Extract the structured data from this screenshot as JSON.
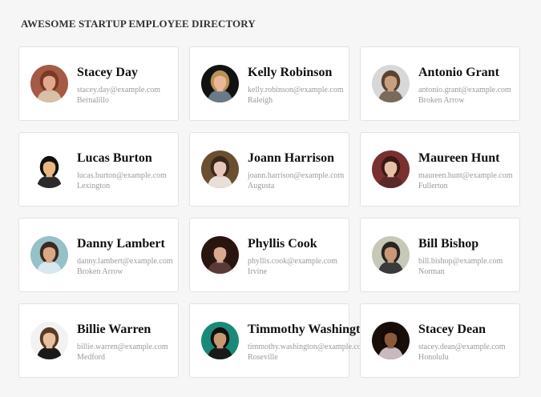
{
  "page": {
    "title": "AWESOME STARTUP EMPLOYEE DIRECTORY"
  },
  "employees": [
    {
      "name": "Stacey Day",
      "email": "stacey.day@example.com",
      "city": "Bernalillo",
      "avatar": {
        "bg": "#a45a44",
        "skin": "#e0a88c",
        "hair": "#7a3a22",
        "shirt": "#d8c0a8"
      }
    },
    {
      "name": "Kelly Robinson",
      "email": "kelly.robinson@example.com",
      "city": "Raleigh",
      "avatar": {
        "bg": "#121212",
        "skin": "#e8b898",
        "hair": "#b89058",
        "shirt": "#6a7a88"
      }
    },
    {
      "name": "Antonio Grant",
      "email": "antonio.grant@example.com",
      "city": "Broken Arrow",
      "avatar": {
        "bg": "#d8d8d8",
        "skin": "#c8a080",
        "hair": "#5a4430",
        "shirt": "#7a6a5a"
      }
    },
    {
      "name": "Lucas Burton",
      "email": "lucas.burton@example.com",
      "city": "Lexington",
      "avatar": {
        "bg": "#ffffff",
        "skin": "#e8b880",
        "hair": "#111111",
        "shirt": "#2a2a2a"
      }
    },
    {
      "name": "Joann Harrison",
      "email": "joann.harrison@example.com",
      "city": "Augusta",
      "avatar": {
        "bg": "#6a5030",
        "skin": "#e8c8b8",
        "hair": "#3a2818",
        "shirt": "#e8e0d8"
      }
    },
    {
      "name": "Maureen Hunt",
      "email": "maureen.hunt@example.com",
      "city": "Fullerton",
      "avatar": {
        "bg": "#7a3030",
        "skin": "#e8c0a8",
        "hair": "#3a1a12",
        "shirt": "#5a2a2a"
      }
    },
    {
      "name": "Danny Lambert",
      "email": "danny.lambert@example.com",
      "city": "Broken Arrow",
      "avatar": {
        "bg": "#98c0c8",
        "skin": "#d8a888",
        "hair": "#3a2a20",
        "shirt": "#d8e8f0"
      }
    },
    {
      "name": "Phyllis Cook",
      "email": "phyllis.cook@example.com",
      "city": "Irvine",
      "avatar": {
        "bg": "#2a1410",
        "skin": "#d8a890",
        "hair": "#2a1610",
        "shirt": "#5a3a38"
      }
    },
    {
      "name": "Bill Bishop",
      "email": "bill.bishop@example.com",
      "city": "Norman",
      "avatar": {
        "bg": "#c8c8b8",
        "skin": "#c89878",
        "hair": "#2a2420",
        "shirt": "#3a3a3a"
      }
    },
    {
      "name": "Billie Warren",
      "email": "billie.warren@example.com",
      "city": "Medford",
      "avatar": {
        "bg": "#f2f2f2",
        "skin": "#e8c0a0",
        "hair": "#5a3a22",
        "shirt": "#1a1a1a"
      }
    },
    {
      "name": "Timmothy Washington",
      "email": "timmothy.washington@example.com",
      "city": "Roseville",
      "avatar": {
        "bg": "#1a8a78",
        "skin": "#c89870",
        "hair": "#111111",
        "shirt": "#1a1a1a"
      }
    },
    {
      "name": "Stacey Dean",
      "email": "stacey.dean@example.com",
      "city": "Honolulu",
      "avatar": {
        "bg": "#1a0e0a",
        "skin": "#8a5a3a",
        "hair": "#140a06",
        "shirt": "#c8b8c0"
      }
    }
  ]
}
